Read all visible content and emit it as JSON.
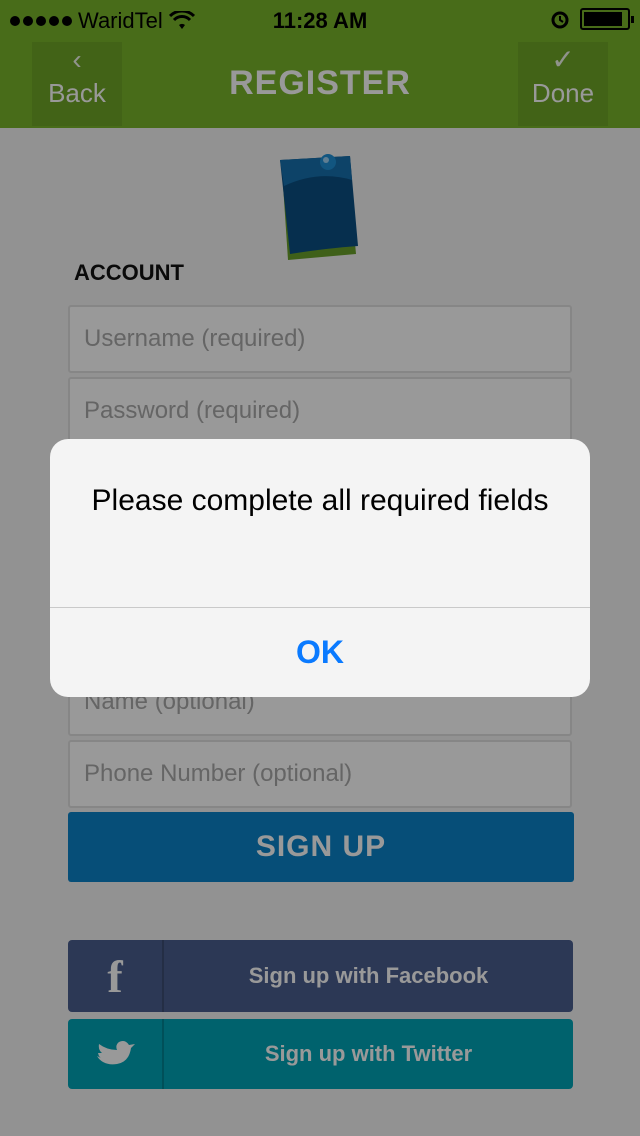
{
  "status_bar": {
    "carrier": "WaridTel",
    "time": "11:28 AM",
    "wifi_icon": "wifi-icon",
    "alarm_icon": "alarm-clock-icon",
    "battery_icon": "battery-icon",
    "battery_level": 0.9
  },
  "nav": {
    "back_label": "Back",
    "title": "REGISTER",
    "done_label": "Done",
    "back_icon": "chevron-left-icon",
    "done_icon": "checkmark-icon"
  },
  "form": {
    "section_label": "ACCOUNT",
    "fields": [
      {
        "placeholder": "Username (required)",
        "value": ""
      },
      {
        "placeholder": "Password (required)",
        "value": ""
      },
      {
        "placeholder": "",
        "value": ""
      },
      {
        "placeholder": "",
        "value": ""
      },
      {
        "placeholder": "",
        "value": ""
      },
      {
        "placeholder": "Name (optional)",
        "value": ""
      },
      {
        "placeholder": "Phone Number (optional)",
        "value": ""
      }
    ],
    "signup_label": "SIGN UP"
  },
  "social": {
    "facebook_label": "Sign up with Facebook",
    "twitter_label": "Sign up with Twitter",
    "facebook_icon": "facebook-icon",
    "twitter_icon": "twitter-bird-icon"
  },
  "alert": {
    "message": "Please complete all required fields",
    "ok_label": "OK"
  },
  "colors": {
    "brand_green": "#79b52b",
    "signup_blue": "#0b83c8",
    "facebook": "#4a5e8e",
    "twitter": "#00a4b6",
    "ios_blue": "#0a7aff"
  }
}
